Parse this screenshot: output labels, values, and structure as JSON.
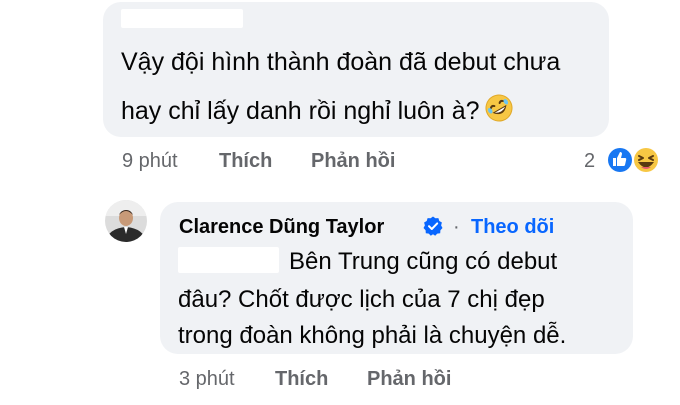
{
  "comment1": {
    "line1": "Vậy đội hình thành đoàn đã debut chưa",
    "line2": "hay chỉ lấy danh rồi nghỉ luôn à?",
    "emoji": "rolling-on-floor-laughing-emoji",
    "time": "9 phút",
    "like_label": "Thích",
    "reply_label": "Phản hồi",
    "reaction_count": "2",
    "reactions": [
      "like-reaction-icon",
      "haha-reaction-icon"
    ]
  },
  "comment2": {
    "author": "Clarence Dũng Taylor",
    "dot": "·",
    "follow_label": "Theo dõi",
    "line1": "Bên Trung cũng có debut",
    "line2": "đâu? Chốt được lịch của 7 chị đẹp",
    "line3": "trong đoàn không phải là chuyện dễ.",
    "time": "3 phút",
    "like_label": "Thích",
    "reply_label": "Phản hồi"
  },
  "colors": {
    "bubble": "#f0f2f5",
    "meta_text": "#65676b",
    "link_blue": "#0866ff",
    "like_blue": "#1877f2",
    "haha_yellow": "#f7c744"
  }
}
